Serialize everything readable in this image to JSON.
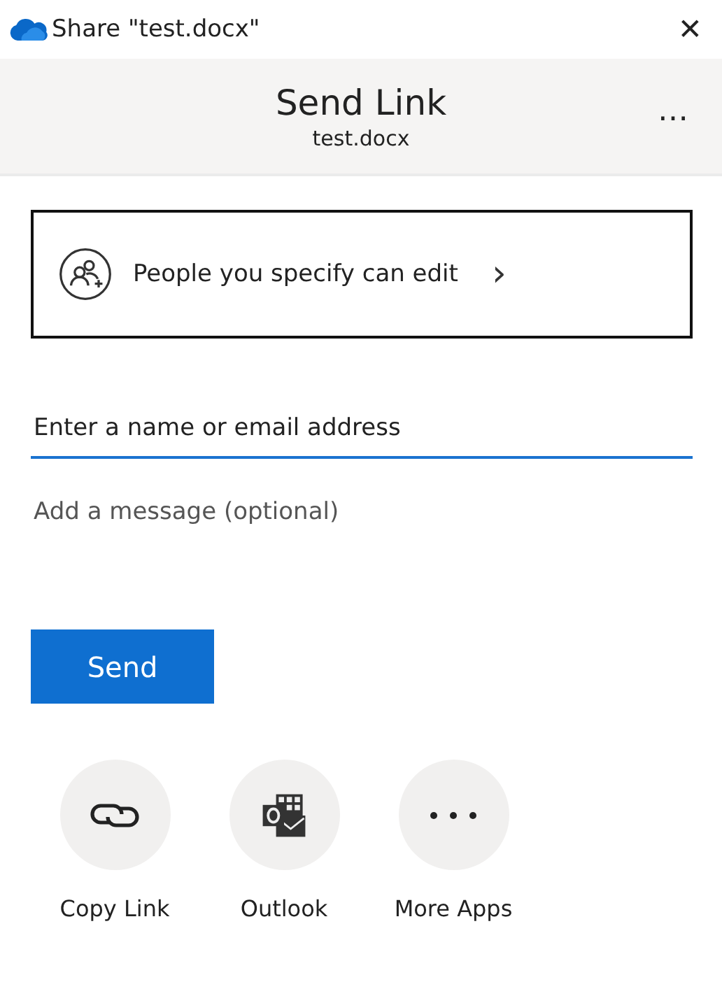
{
  "window": {
    "title": "Share \"test.docx\"",
    "close": "✕"
  },
  "header": {
    "title": "Send Link",
    "subtitle": "test.docx",
    "more": "…"
  },
  "permission": {
    "label": "People you specify can edit",
    "chevron": "›"
  },
  "recipient": {
    "placeholder": "Enter a name or email address"
  },
  "message": {
    "placeholder": "Add a message (optional)"
  },
  "send_button": "Send",
  "apps": [
    {
      "kind": "link",
      "label": "Copy Link"
    },
    {
      "kind": "outlook",
      "label": "Outlook"
    },
    {
      "kind": "more",
      "label": "More Apps"
    }
  ]
}
